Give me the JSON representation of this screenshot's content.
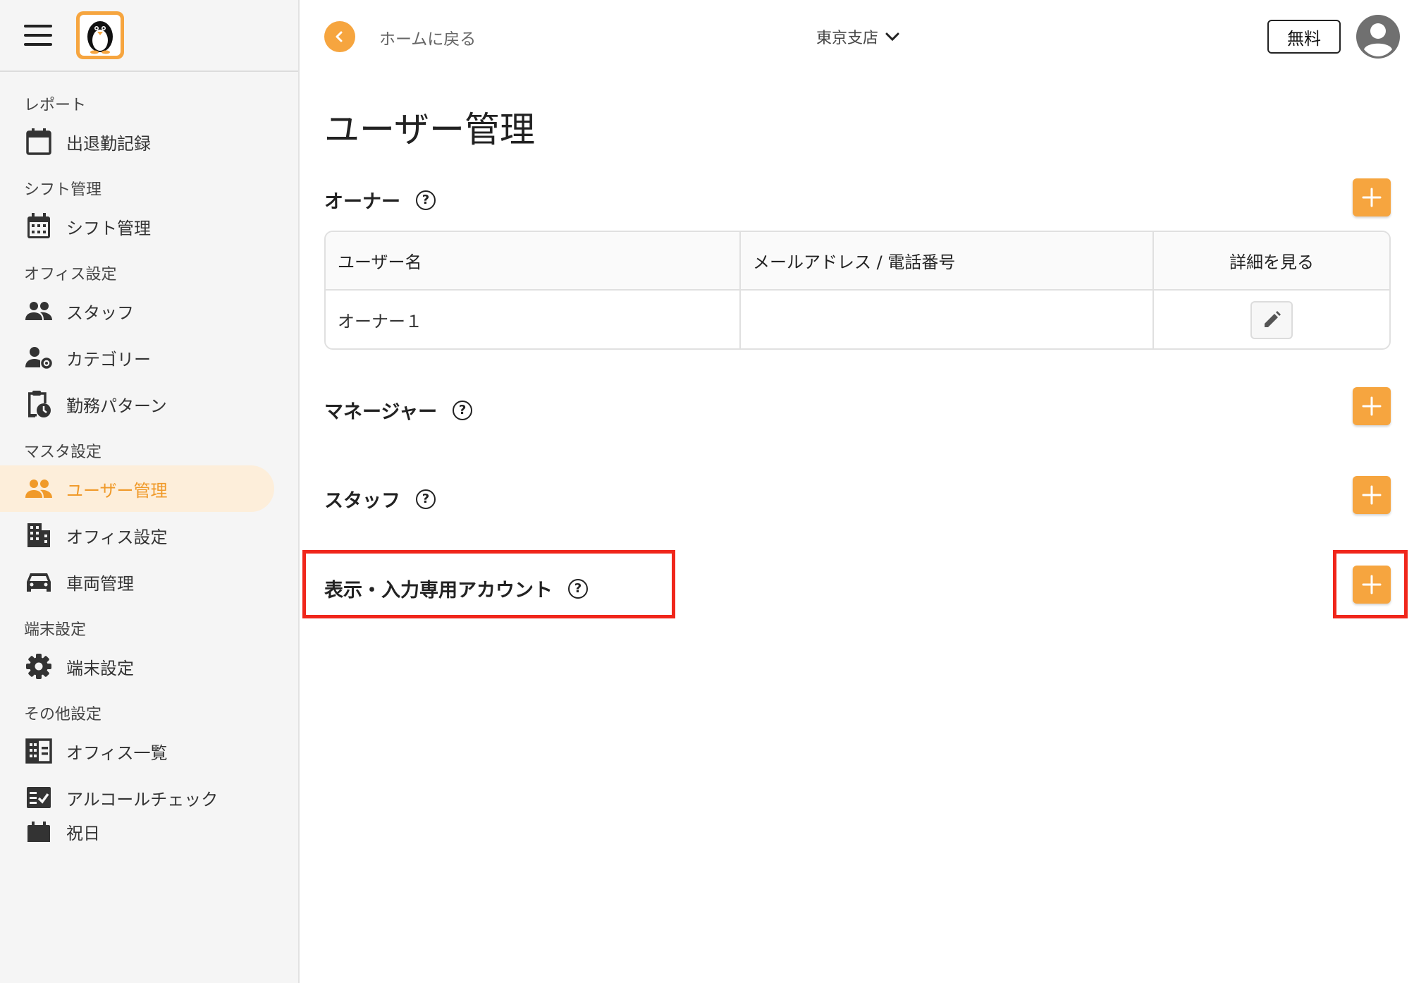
{
  "header": {
    "back_label": "ホームに戻る",
    "branch": "東京支店",
    "plan": "無料"
  },
  "sidebar": {
    "sections": [
      {
        "title": "レポート",
        "items": [
          "出退勤記録"
        ]
      },
      {
        "title": "シフト管理",
        "items": [
          "シフト管理"
        ]
      },
      {
        "title": "オフィス設定",
        "items": [
          "スタッフ",
          "カテゴリー",
          "勤務パターン"
        ]
      },
      {
        "title": "マスタ設定",
        "items": [
          "ユーザー管理",
          "オフィス設定",
          "車両管理"
        ]
      },
      {
        "title": "端末設定",
        "items": [
          "端末設定"
        ]
      },
      {
        "title": "その他設定",
        "items": [
          "オフィス一覧",
          "アルコールチェック",
          "祝日"
        ]
      }
    ],
    "active_item": "ユーザー管理"
  },
  "main": {
    "title": "ユーザー管理",
    "owner": {
      "label": "オーナー",
      "columns": [
        "ユーザー名",
        "メールアドレス / 電話番号",
        "詳細を見る"
      ],
      "rows": [
        {
          "name": "オーナー１",
          "contact": ""
        }
      ]
    },
    "manager": {
      "label": "マネージャー"
    },
    "staff": {
      "label": "スタッフ"
    },
    "view_only": {
      "label": "表示・入力専用アカウント"
    },
    "help_glyph": "?"
  },
  "colors": {
    "accent": "#f6a53f",
    "active_bg": "#fdeeda",
    "active_text": "#f09a2a",
    "highlight": "#f0261b"
  }
}
